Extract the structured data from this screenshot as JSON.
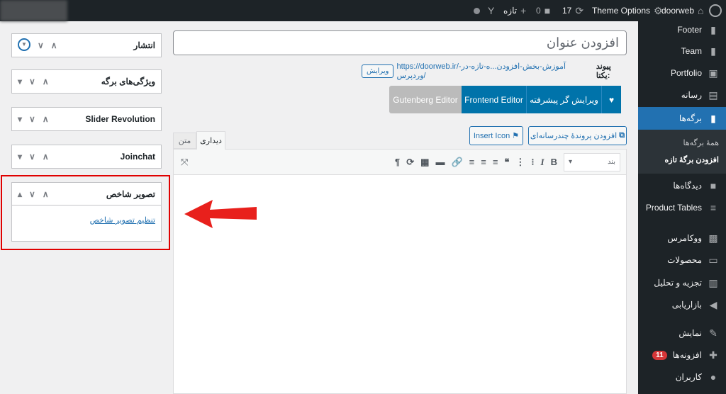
{
  "adminbar": {
    "site": "doorweb",
    "theme_options": "Theme Options",
    "updates": "17",
    "comments": "0",
    "new": "تازه"
  },
  "sidebar": {
    "items": [
      {
        "label": "Footer",
        "icon": "page-icon"
      },
      {
        "label": "Team",
        "icon": "page-icon"
      },
      {
        "label": "Portfolio",
        "icon": "portfolio-icon"
      },
      {
        "label": "رسانه",
        "icon": "media-icon"
      },
      {
        "label": "برگه‌ها",
        "icon": "page-icon",
        "active": true
      },
      {
        "label": "دیدگاه‌ها",
        "icon": "comment-icon"
      },
      {
        "label": "Product Tables",
        "icon": "list-icon"
      },
      {
        "label": "ووکامرس",
        "icon": "woo-icon"
      },
      {
        "label": "محصولات",
        "icon": "archive-icon"
      },
      {
        "label": "تجزیه و تحلیل",
        "icon": "chart-icon"
      },
      {
        "label": "بازاریابی",
        "icon": "megaphone-icon"
      },
      {
        "label": "نمایش",
        "icon": "brush-icon"
      },
      {
        "label": "افزونه‌ها",
        "icon": "plugin-icon",
        "badge": "11"
      },
      {
        "label": "کاربران",
        "icon": "user-icon"
      }
    ],
    "submenu": [
      "همهٔ برگه‌ها",
      "افزودن برگهٔ تازه"
    ]
  },
  "editor": {
    "title_placeholder": "افزودن عنوان",
    "permalink_label": "پیوند یکتا:",
    "permalink_base": "https://doorweb.ir",
    "permalink_slug": "/آموزش-بخش-افزودن...ه-تازه-در-وردپرس/",
    "permalink_edit": "ویرایش",
    "builder_buttons": [
      "ویرایش گر پیشرفته",
      "Frontend Editor",
      "Gutenberg Editor"
    ],
    "add_media": "افزودن پروندهٔ چندرسانه‌ای",
    "insert_icon": "Insert Icon",
    "tab_visual": "دیداری",
    "tab_text": "متن",
    "format_select": "بند"
  },
  "boxes": [
    "انتشار",
    "ویژگی‌های برگه",
    "Slider Revolution",
    "Joinchat",
    "تصویر شاخص"
  ],
  "featured_link": "تنظیم تصویر شاخص",
  "colors": {
    "highlight": "#e00000",
    "accent": "#2271b1"
  }
}
